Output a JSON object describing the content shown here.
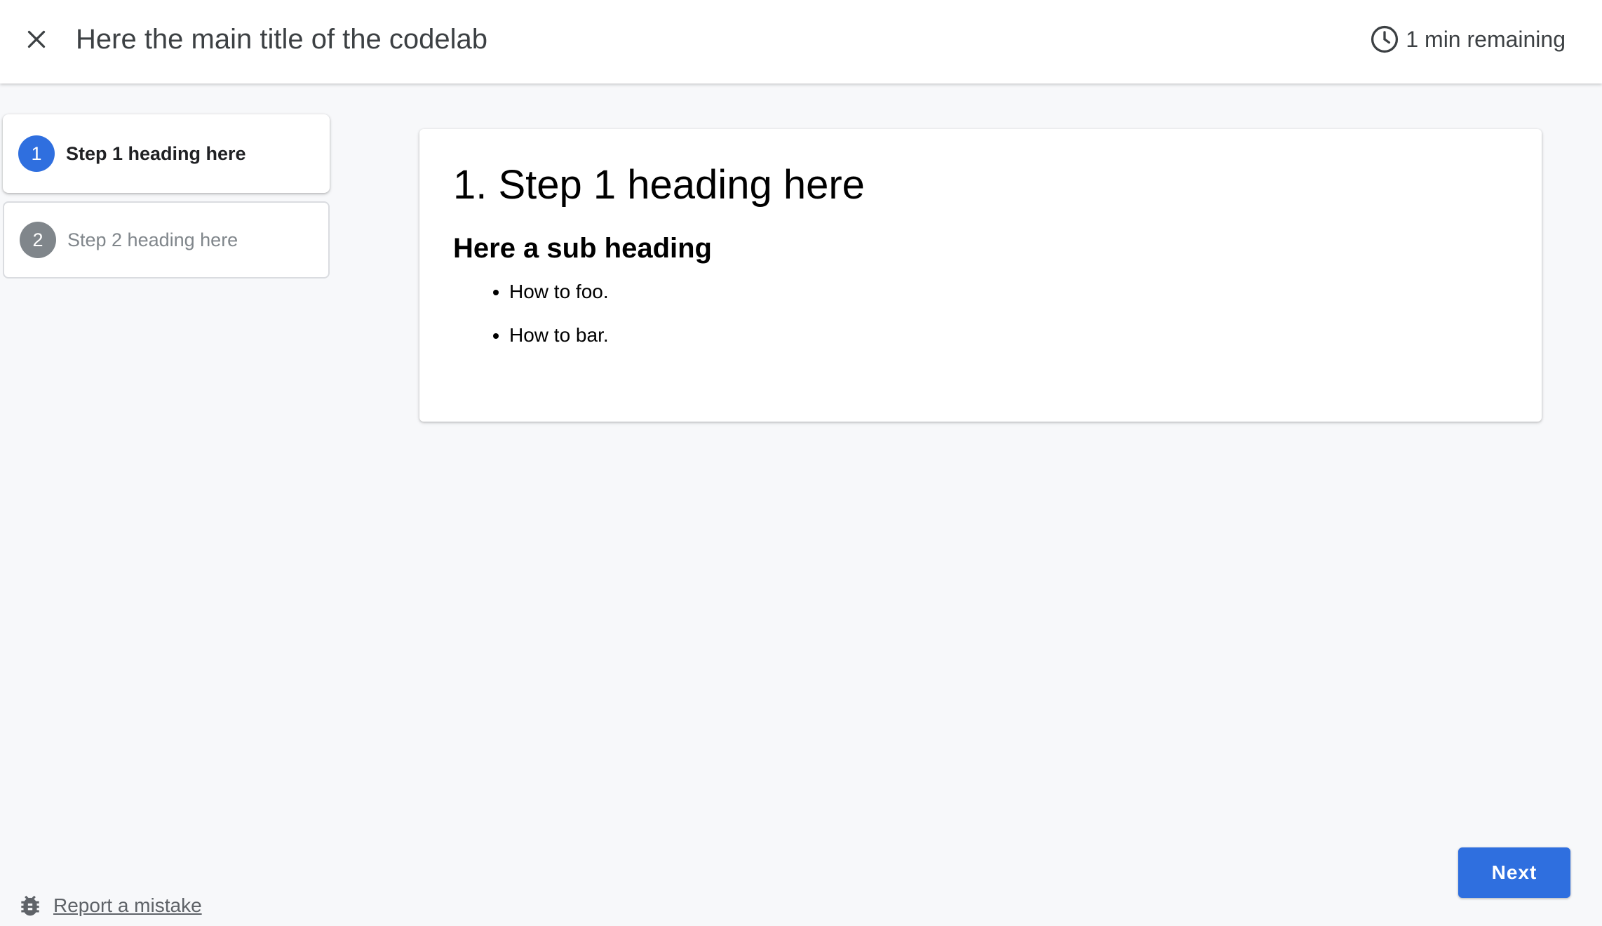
{
  "header": {
    "title": "Here the main title of the codelab",
    "time_remaining": "1 min remaining",
    "close_icon": "close-icon",
    "clock_icon": "clock-icon"
  },
  "steps": [
    {
      "number": "1",
      "label": "Step 1 heading here",
      "active": true
    },
    {
      "number": "2",
      "label": "Step 2 heading here",
      "active": false
    }
  ],
  "content": {
    "title": "1. Step 1 heading here",
    "sub_heading": "Here a sub heading",
    "bullets": [
      "How to foo.",
      "How to bar."
    ]
  },
  "footer": {
    "next_label": "Next",
    "report_label": "Report a mistake",
    "bug_icon": "bug-icon"
  },
  "colors": {
    "accent": "#2f6fdf",
    "inactive": "#80868b",
    "background": "#f7f8fa"
  }
}
